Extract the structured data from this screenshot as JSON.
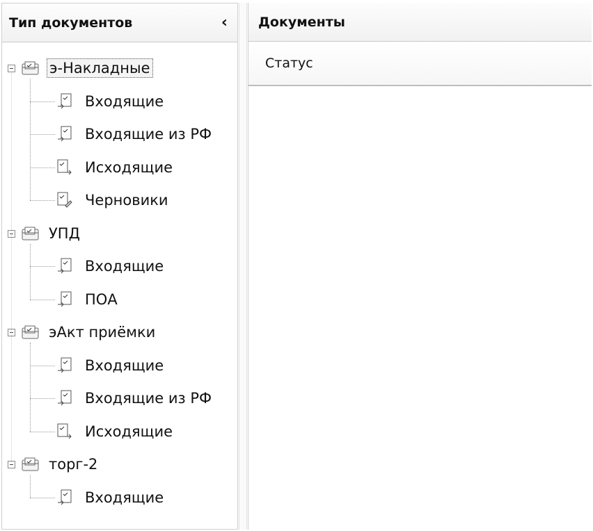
{
  "left_panel": {
    "title": "Тип документов",
    "collapse_glyph": "‹"
  },
  "tree": [
    {
      "label": "э-Накладные",
      "selected": true,
      "children": [
        "Входящие",
        "Входящие из РФ",
        "Исходящие",
        "Черновики"
      ]
    },
    {
      "label": "УПД",
      "selected": false,
      "children": [
        "Входящие",
        "ПОА"
      ]
    },
    {
      "label": "эАкт приёмки",
      "selected": false,
      "children": [
        "Входящие",
        "Входящие из РФ",
        "Исходящие"
      ]
    },
    {
      "label": "торг-2",
      "selected": false,
      "children": [
        "Входящие"
      ]
    }
  ],
  "right_panel": {
    "title": "Документы",
    "column_status": "Статус"
  },
  "icons": {
    "group": "folder-docs-icon",
    "incoming": "incoming-doc-icon",
    "outgoing": "outgoing-doc-icon",
    "draft": "draft-doc-icon",
    "expander": "minus-expander-icon"
  }
}
